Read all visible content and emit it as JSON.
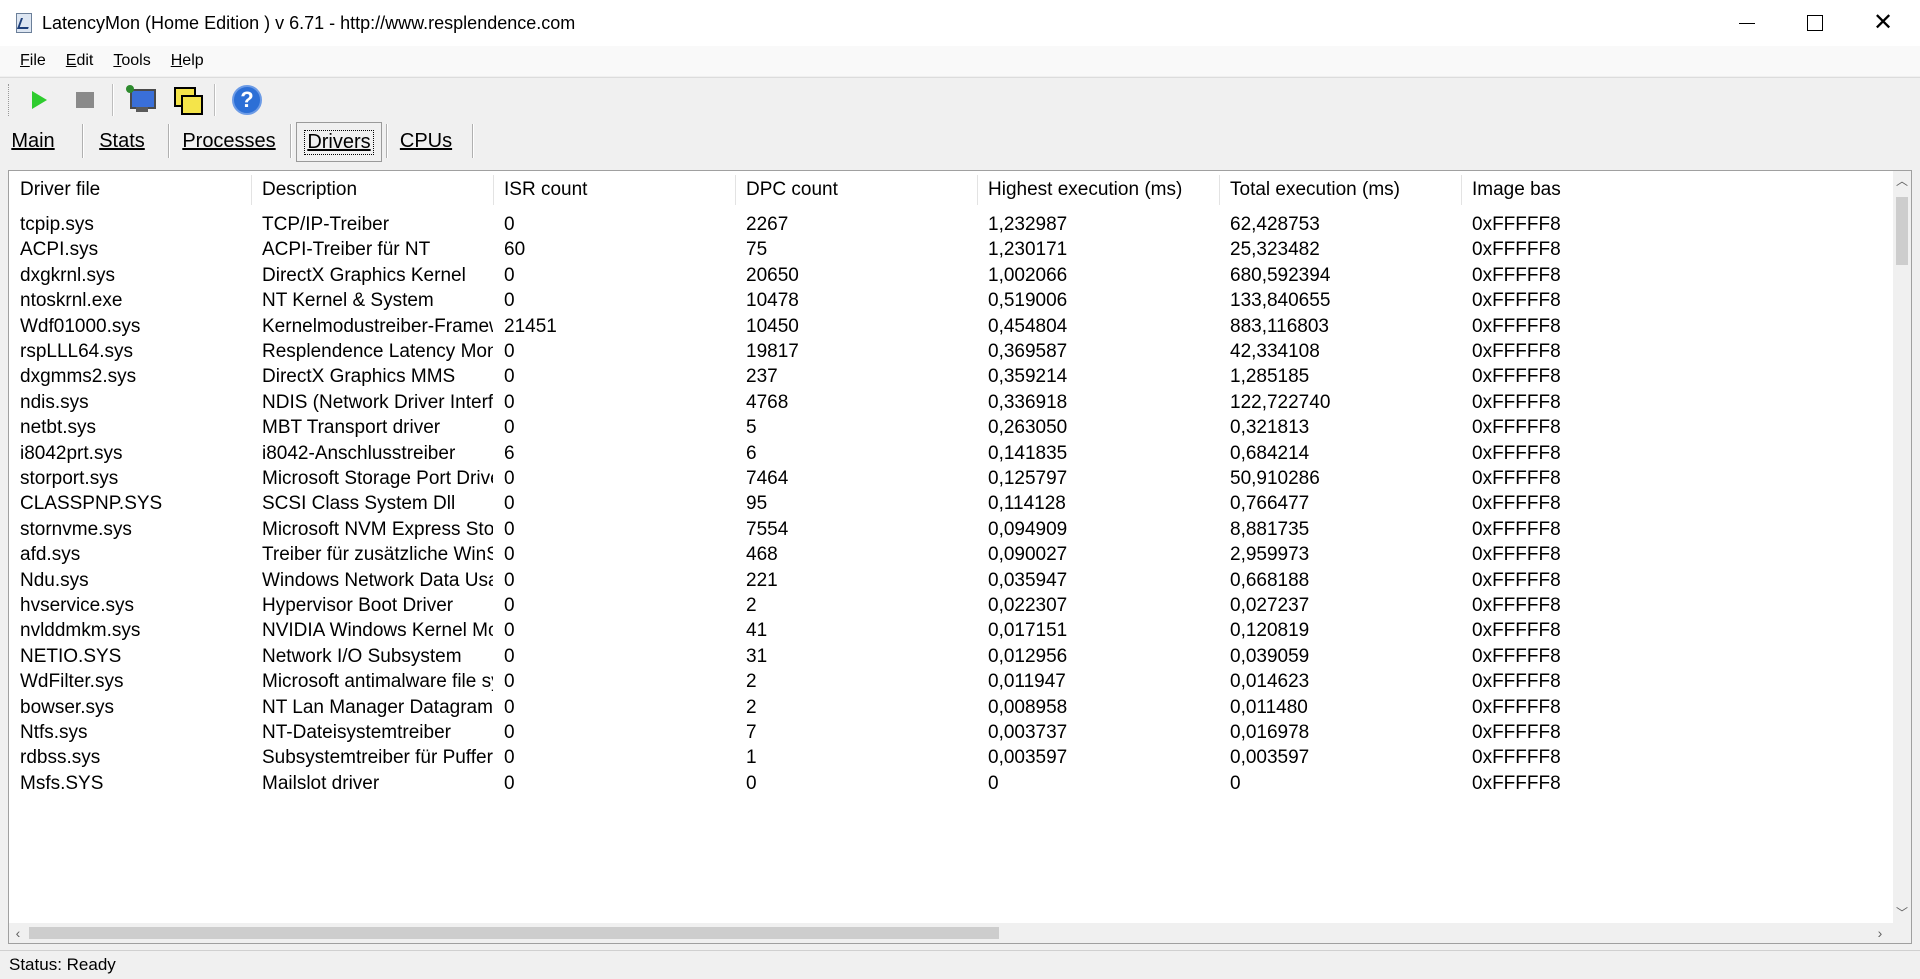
{
  "window": {
    "title": "LatencyMon  (Home Edition )  v 6.71 - http://www.resplendence.com",
    "minimize_icon": "minimize-icon",
    "maximize_icon": "maximize-icon",
    "close_icon": "close-icon"
  },
  "menu": {
    "items": [
      {
        "label": "File",
        "accel": "F",
        "rest": "ile"
      },
      {
        "label": "Edit",
        "accel": "E",
        "rest": "dit"
      },
      {
        "label": "Tools",
        "accel": "T",
        "rest": "ools"
      },
      {
        "label": "Help",
        "accel": "H",
        "rest": "elp"
      }
    ]
  },
  "toolbar": {
    "buttons": [
      {
        "name": "start",
        "icon": "play-icon"
      },
      {
        "name": "stop",
        "icon": "stop-icon"
      },
      {
        "name": "system-settings",
        "icon": "monitor-settings-icon"
      },
      {
        "name": "windows",
        "icon": "windows-icon"
      },
      {
        "name": "help",
        "icon": "help-icon",
        "glyph": "?"
      }
    ]
  },
  "tabs": {
    "items": [
      {
        "label": "Main",
        "active": false
      },
      {
        "label": "Stats",
        "active": false
      },
      {
        "label": "Processes",
        "active": false
      },
      {
        "label": "Drivers",
        "active": true
      },
      {
        "label": "CPUs",
        "active": false
      }
    ]
  },
  "table": {
    "columns": [
      "Driver file",
      "Description",
      "ISR count",
      "DPC count",
      "Highest execution (ms)",
      "Total execution (ms)",
      "Image bas"
    ],
    "rows": [
      [
        "tcpip.sys",
        "TCP/IP-Treiber",
        "0",
        "2267",
        "1,232987",
        "62,428753",
        "0xFFFFF8"
      ],
      [
        "ACPI.sys",
        "ACPI-Treiber für NT",
        "60",
        "75",
        "1,230171",
        "25,323482",
        "0xFFFFF8"
      ],
      [
        "dxgkrnl.sys",
        "DirectX Graphics Kernel",
        "0",
        "20650",
        "1,002066",
        "680,592394",
        "0xFFFFF8"
      ],
      [
        "ntoskrnl.exe",
        "NT Kernel & System",
        "0",
        "10478",
        "0,519006",
        "133,840655",
        "0xFFFFF8"
      ],
      [
        "Wdf01000.sys",
        "Kernelmodustreiber-Framew...",
        "21451",
        "10450",
        "0,454804",
        "883,116803",
        "0xFFFFF8"
      ],
      [
        "rspLLL64.sys",
        "Resplendence Latency Monit...",
        "0",
        "19817",
        "0,369587",
        "42,334108",
        "0xFFFFF8"
      ],
      [
        "dxgmms2.sys",
        "DirectX Graphics MMS",
        "0",
        "237",
        "0,359214",
        "1,285185",
        "0xFFFFF8"
      ],
      [
        "ndis.sys",
        "NDIS (Network Driver Interf...",
        "0",
        "4768",
        "0,336918",
        "122,722740",
        "0xFFFFF8"
      ],
      [
        "netbt.sys",
        "MBT Transport driver",
        "0",
        "5",
        "0,263050",
        "0,321813",
        "0xFFFFF8"
      ],
      [
        "i8042prt.sys",
        "i8042-Anschlusstreiber",
        "6",
        "6",
        "0,141835",
        "0,684214",
        "0xFFFFF8"
      ],
      [
        "storport.sys",
        "Microsoft Storage Port Driver",
        "0",
        "7464",
        "0,125797",
        "50,910286",
        "0xFFFFF8"
      ],
      [
        "CLASSPNP.SYS",
        "SCSI Class System Dll",
        "0",
        "95",
        "0,114128",
        "0,766477",
        "0xFFFFF8"
      ],
      [
        "stornvme.sys",
        "Microsoft NVM Express Stor...",
        "0",
        "7554",
        "0,094909",
        "8,881735",
        "0xFFFFF8"
      ],
      [
        "afd.sys",
        "Treiber für zusätzliche WinS...",
        "0",
        "468",
        "0,090027",
        "2,959973",
        "0xFFFFF8"
      ],
      [
        "Ndu.sys",
        "Windows Network Data Usa...",
        "0",
        "221",
        "0,035947",
        "0,668188",
        "0xFFFFF8"
      ],
      [
        "hvservice.sys",
        "Hypervisor Boot Driver",
        "0",
        "2",
        "0,022307",
        "0,027237",
        "0xFFFFF8"
      ],
      [
        "nvlddmkm.sys",
        "NVIDIA Windows Kernel Mod...",
        "0",
        "41",
        "0,017151",
        "0,120819",
        "0xFFFFF8"
      ],
      [
        "NETIO.SYS",
        "Network I/O Subsystem",
        "0",
        "31",
        "0,012956",
        "0,039059",
        "0xFFFFF8"
      ],
      [
        "WdFilter.sys",
        "Microsoft antimalware file sys...",
        "0",
        "2",
        "0,011947",
        "0,014623",
        "0xFFFFF8"
      ],
      [
        "bowser.sys",
        "NT Lan Manager Datagram ...",
        "0",
        "2",
        "0,008958",
        "0,011480",
        "0xFFFFF8"
      ],
      [
        "Ntfs.sys",
        "NT-Dateisystemtreiber",
        "0",
        "7",
        "0,003737",
        "0,016978",
        "0xFFFFF8"
      ],
      [
        "rdbss.sys",
        "Subsystemtreiber für Puffer...",
        "0",
        "1",
        "0,003597",
        "0,003597",
        "0xFFFFF8"
      ],
      [
        "Msfs.SYS",
        "Mailslot driver",
        "0",
        "0",
        "0",
        "0",
        "0xFFFFF8"
      ]
    ]
  },
  "scrollbars": {
    "up_icon": "scroll-up-icon",
    "down_icon": "scroll-down-icon",
    "left_icon": "scroll-left-icon",
    "right_icon": "scroll-right-icon"
  },
  "status": {
    "text": "Status: Ready"
  }
}
